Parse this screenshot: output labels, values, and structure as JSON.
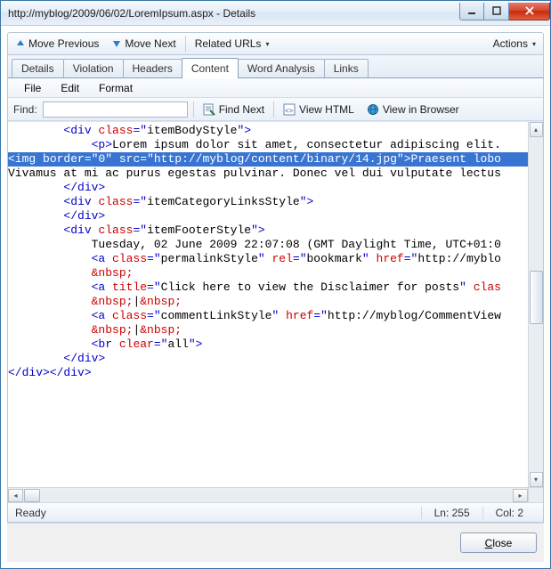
{
  "window": {
    "title": "http://myblog/2009/06/02/LoremIpsum.aspx - Details"
  },
  "nav": {
    "move_previous": "Move Previous",
    "move_next": "Move Next",
    "related_urls": "Related URLs",
    "actions": "Actions"
  },
  "tabs": [
    "Details",
    "Violation",
    "Headers",
    "Content",
    "Word Analysis",
    "Links"
  ],
  "active_tab": "Content",
  "menu": {
    "file": "File",
    "edit": "Edit",
    "format": "Format"
  },
  "find": {
    "label": "Find:",
    "value": "",
    "find_next": "Find Next",
    "view_html": "View HTML",
    "view_browser": "View in Browser"
  },
  "code_lines": [
    {
      "indent": 8,
      "segments": [
        {
          "t": "<div ",
          "c": "blue"
        },
        {
          "t": "class",
          "c": "red"
        },
        {
          "t": "=\"",
          "c": "blue"
        },
        {
          "t": "itemBodyStyle",
          "c": "black"
        },
        {
          "t": "\">",
          "c": "blue"
        }
      ]
    },
    {
      "indent": 12,
      "segments": [
        {
          "t": "<p>",
          "c": "blue"
        },
        {
          "t": "Lorem ipsum dolor sit amet, consectetur adipiscing elit.",
          "c": "black"
        }
      ]
    },
    {
      "indent": 0,
      "segments": []
    },
    {
      "indent": 0,
      "hl": true,
      "segments": [
        {
          "t": "<img ",
          "c": "blue"
        },
        {
          "t": "border",
          "c": "red"
        },
        {
          "t": "=\"",
          "c": "blue"
        },
        {
          "t": "0",
          "c": "black"
        },
        {
          "t": "\" ",
          "c": "blue"
        },
        {
          "t": "src",
          "c": "red"
        },
        {
          "t": "=\"",
          "c": "blue"
        },
        {
          "t": "http://myblog/content/binary/14.jpg",
          "c": "black"
        },
        {
          "t": "\">",
          "c": "blue"
        },
        {
          "t": "Praesent lobo",
          "c": "black"
        }
      ]
    },
    {
      "indent": 0,
      "segments": []
    },
    {
      "indent": 0,
      "segments": [
        {
          "t": "Vivamus at mi ac purus egestas pulvinar. Donec vel dui vulputate lectus",
          "c": "black"
        }
      ]
    },
    {
      "indent": 8,
      "segments": [
        {
          "t": "</div>",
          "c": "blue"
        }
      ]
    },
    {
      "indent": 8,
      "segments": [
        {
          "t": "<div ",
          "c": "blue"
        },
        {
          "t": "class",
          "c": "red"
        },
        {
          "t": "=\"",
          "c": "blue"
        },
        {
          "t": "itemCategoryLinksStyle",
          "c": "black"
        },
        {
          "t": "\">",
          "c": "blue"
        }
      ]
    },
    {
      "indent": 0,
      "segments": []
    },
    {
      "indent": 8,
      "segments": [
        {
          "t": "</div>",
          "c": "blue"
        }
      ]
    },
    {
      "indent": 8,
      "segments": [
        {
          "t": "<div ",
          "c": "blue"
        },
        {
          "t": "class",
          "c": "red"
        },
        {
          "t": "=\"",
          "c": "blue"
        },
        {
          "t": "itemFooterStyle",
          "c": "black"
        },
        {
          "t": "\">",
          "c": "blue"
        }
      ]
    },
    {
      "indent": 12,
      "segments": [
        {
          "t": "Tuesday, 02 June 2009 22:07:08 (GMT Daylight Time, UTC+01:0",
          "c": "black"
        }
      ]
    },
    {
      "indent": 12,
      "segments": [
        {
          "t": "<a ",
          "c": "blue"
        },
        {
          "t": "class",
          "c": "red"
        },
        {
          "t": "=\"",
          "c": "blue"
        },
        {
          "t": "permalinkStyle",
          "c": "black"
        },
        {
          "t": "\" ",
          "c": "blue"
        },
        {
          "t": "rel",
          "c": "red"
        },
        {
          "t": "=\"",
          "c": "blue"
        },
        {
          "t": "bookmark",
          "c": "black"
        },
        {
          "t": "\" ",
          "c": "blue"
        },
        {
          "t": "href",
          "c": "red"
        },
        {
          "t": "=\"",
          "c": "blue"
        },
        {
          "t": "http://myblo",
          "c": "black"
        }
      ]
    },
    {
      "indent": 12,
      "segments": [
        {
          "t": "&nbsp;",
          "c": "red"
        }
      ]
    },
    {
      "indent": 12,
      "segments": [
        {
          "t": "<a ",
          "c": "blue"
        },
        {
          "t": "title",
          "c": "red"
        },
        {
          "t": "=\"",
          "c": "blue"
        },
        {
          "t": "Click here to view the Disclaimer for posts",
          "c": "black"
        },
        {
          "t": "\" ",
          "c": "blue"
        },
        {
          "t": "clas",
          "c": "red"
        }
      ]
    },
    {
      "indent": 12,
      "segments": [
        {
          "t": "&nbsp;",
          "c": "red"
        },
        {
          "t": "|",
          "c": "black"
        },
        {
          "t": "&nbsp;",
          "c": "red"
        }
      ]
    },
    {
      "indent": 12,
      "segments": [
        {
          "t": "<a ",
          "c": "blue"
        },
        {
          "t": "class",
          "c": "red"
        },
        {
          "t": "=\"",
          "c": "blue"
        },
        {
          "t": "commentLinkStyle",
          "c": "black"
        },
        {
          "t": "\" ",
          "c": "blue"
        },
        {
          "t": "href",
          "c": "red"
        },
        {
          "t": "=\"",
          "c": "blue"
        },
        {
          "t": "http://myblog/CommentView",
          "c": "black"
        }
      ]
    },
    {
      "indent": 12,
      "segments": [
        {
          "t": "&nbsp;",
          "c": "red"
        },
        {
          "t": "|",
          "c": "black"
        },
        {
          "t": "&nbsp;",
          "c": "red"
        }
      ]
    },
    {
      "indent": 0,
      "segments": []
    },
    {
      "indent": 0,
      "segments": []
    },
    {
      "indent": 0,
      "segments": []
    },
    {
      "indent": 12,
      "segments": [
        {
          "t": "<br ",
          "c": "blue"
        },
        {
          "t": "clear",
          "c": "red"
        },
        {
          "t": "=\"",
          "c": "blue"
        },
        {
          "t": "all",
          "c": "black"
        },
        {
          "t": "\">",
          "c": "blue"
        }
      ]
    },
    {
      "indent": 8,
      "segments": [
        {
          "t": "</div>",
          "c": "blue"
        }
      ]
    },
    {
      "indent": 0,
      "segments": [
        {
          "t": "</div></div>",
          "c": "blue"
        }
      ]
    }
  ],
  "status": {
    "ready": "Ready",
    "line": "Ln: 255",
    "col": "Col: 2"
  },
  "footer": {
    "close": "Close"
  }
}
